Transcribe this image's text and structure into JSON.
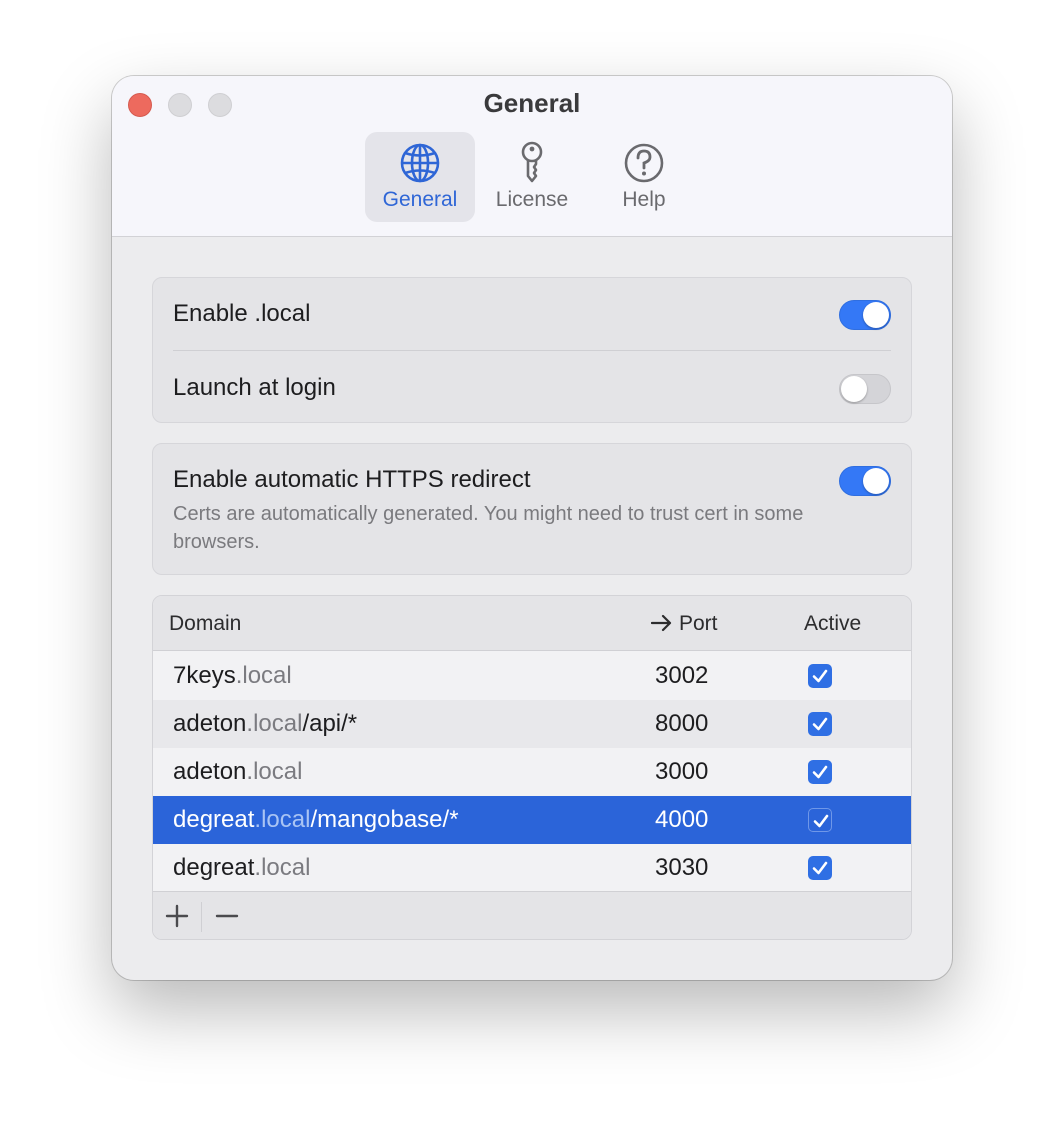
{
  "window": {
    "title": "General"
  },
  "tabs": [
    {
      "label": "General",
      "icon": "globe-icon",
      "active": true
    },
    {
      "label": "License",
      "icon": "key-icon",
      "active": false
    },
    {
      "label": "Help",
      "icon": "question-circle-icon",
      "active": false
    }
  ],
  "settings": {
    "enable_local": {
      "label": "Enable .local",
      "on": true
    },
    "launch_at_login": {
      "label": "Launch at login",
      "on": false
    },
    "https_redirect": {
      "label": "Enable automatic HTTPS redirect",
      "description": "Certs are automatically generated. You might need to trust cert in some browsers.",
      "on": true
    }
  },
  "table": {
    "columns": {
      "domain": "Domain",
      "port": "Port",
      "active": "Active"
    },
    "rows": [
      {
        "name": "7keys",
        "tld": ".local",
        "path": "",
        "port": "3002",
        "active": true,
        "selected": false
      },
      {
        "name": "adeton",
        "tld": ".local",
        "path": "/api/*",
        "port": "8000",
        "active": true,
        "selected": false
      },
      {
        "name": "adeton",
        "tld": ".local",
        "path": "",
        "port": "3000",
        "active": true,
        "selected": false
      },
      {
        "name": "degreat",
        "tld": ".local",
        "path": "/mangobase/*",
        "port": "4000",
        "active": true,
        "selected": true
      },
      {
        "name": "degreat",
        "tld": ".local",
        "path": "",
        "port": "3030",
        "active": true,
        "selected": false
      }
    ],
    "add_label": "+",
    "remove_label": "−"
  },
  "colors": {
    "accent": "#3478f6",
    "selection": "#2b64d9",
    "close": "#ed6a5e"
  }
}
